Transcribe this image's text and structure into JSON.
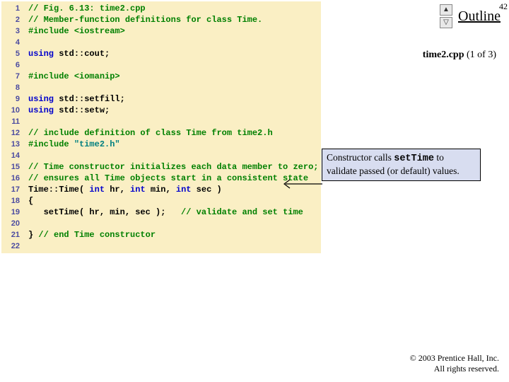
{
  "page_number": "42",
  "outline": {
    "label": "Outline",
    "up": "▲",
    "down": "▽"
  },
  "file_caption": {
    "name": "time2.cpp",
    "part": "(1 of 3)"
  },
  "code": [
    {
      "n": "1",
      "segs": [
        [
          "c-comment",
          "// Fig. 6.13: time2.cpp"
        ]
      ]
    },
    {
      "n": "2",
      "segs": [
        [
          "c-comment",
          "// Member-function definitions for class Time."
        ]
      ]
    },
    {
      "n": "3",
      "segs": [
        [
          "c-pre",
          "#include "
        ],
        [
          "c-pre",
          "<iostream>"
        ]
      ]
    },
    {
      "n": "4",
      "segs": [
        [
          "c-plain",
          ""
        ]
      ]
    },
    {
      "n": "5",
      "segs": [
        [
          "c-key",
          "using "
        ],
        [
          "c-plain",
          "std::cout;"
        ]
      ]
    },
    {
      "n": "6",
      "segs": [
        [
          "c-plain",
          ""
        ]
      ]
    },
    {
      "n": "7",
      "segs": [
        [
          "c-pre",
          "#include "
        ],
        [
          "c-pre",
          "<iomanip>"
        ]
      ]
    },
    {
      "n": "8",
      "segs": [
        [
          "c-plain",
          ""
        ]
      ]
    },
    {
      "n": "9",
      "segs": [
        [
          "c-key",
          "using "
        ],
        [
          "c-plain",
          "std::setfill;"
        ]
      ]
    },
    {
      "n": "10",
      "segs": [
        [
          "c-key",
          "using "
        ],
        [
          "c-plain",
          "std::setw;"
        ]
      ]
    },
    {
      "n": "11",
      "segs": [
        [
          "c-plain",
          ""
        ]
      ]
    },
    {
      "n": "12",
      "segs": [
        [
          "c-comment",
          "// include definition of class Time from time2.h"
        ]
      ]
    },
    {
      "n": "13",
      "segs": [
        [
          "c-pre",
          "#include "
        ],
        [
          "c-str",
          "\"time2.h\""
        ]
      ]
    },
    {
      "n": "14",
      "segs": [
        [
          "c-plain",
          ""
        ]
      ]
    },
    {
      "n": "15",
      "segs": [
        [
          "c-comment",
          "// Time constructor initializes each data member to zero;"
        ]
      ]
    },
    {
      "n": "16",
      "segs": [
        [
          "c-comment",
          "// ensures all Time objects start in a consistent state"
        ]
      ]
    },
    {
      "n": "17",
      "segs": [
        [
          "c-plain",
          "Time::Time( "
        ],
        [
          "c-key",
          "int"
        ],
        [
          "c-plain",
          " hr, "
        ],
        [
          "c-key",
          "int"
        ],
        [
          "c-plain",
          " min, "
        ],
        [
          "c-key",
          "int"
        ],
        [
          "c-plain",
          " sec )"
        ]
      ]
    },
    {
      "n": "18",
      "segs": [
        [
          "c-plain",
          "{"
        ]
      ]
    },
    {
      "n": "19",
      "segs": [
        [
          "c-plain",
          "   setTime( hr, min, sec );   "
        ],
        [
          "c-comment",
          "// validate and set time"
        ]
      ]
    },
    {
      "n": "20",
      "segs": [
        [
          "c-plain",
          ""
        ]
      ]
    },
    {
      "n": "21",
      "segs": [
        [
          "c-plain",
          "} "
        ],
        [
          "c-comment",
          "// end Time constructor"
        ]
      ]
    },
    {
      "n": "22",
      "segs": [
        [
          "c-plain",
          ""
        ]
      ]
    }
  ],
  "callout": {
    "t1": "Constructor calls ",
    "mono": "setTime",
    "t2": " to validate passed (or default) values."
  },
  "footer": {
    "l1": "© 2003 Prentice Hall, Inc.",
    "l2": "All rights reserved."
  }
}
